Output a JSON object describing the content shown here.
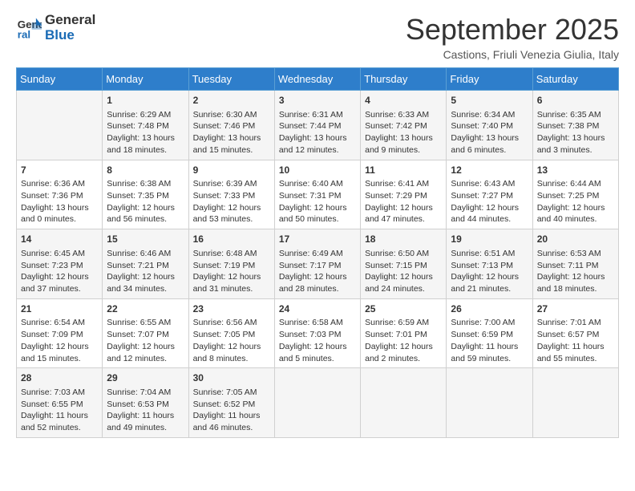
{
  "logo": {
    "line1": "General",
    "line2": "Blue"
  },
  "title": "September 2025",
  "location": "Castions, Friuli Venezia Giulia, Italy",
  "days_of_week": [
    "Sunday",
    "Monday",
    "Tuesday",
    "Wednesday",
    "Thursday",
    "Friday",
    "Saturday"
  ],
  "weeks": [
    [
      {
        "day": "",
        "info": ""
      },
      {
        "day": "1",
        "info": "Sunrise: 6:29 AM\nSunset: 7:48 PM\nDaylight: 13 hours\nand 18 minutes."
      },
      {
        "day": "2",
        "info": "Sunrise: 6:30 AM\nSunset: 7:46 PM\nDaylight: 13 hours\nand 15 minutes."
      },
      {
        "day": "3",
        "info": "Sunrise: 6:31 AM\nSunset: 7:44 PM\nDaylight: 13 hours\nand 12 minutes."
      },
      {
        "day": "4",
        "info": "Sunrise: 6:33 AM\nSunset: 7:42 PM\nDaylight: 13 hours\nand 9 minutes."
      },
      {
        "day": "5",
        "info": "Sunrise: 6:34 AM\nSunset: 7:40 PM\nDaylight: 13 hours\nand 6 minutes."
      },
      {
        "day": "6",
        "info": "Sunrise: 6:35 AM\nSunset: 7:38 PM\nDaylight: 13 hours\nand 3 minutes."
      }
    ],
    [
      {
        "day": "7",
        "info": "Sunrise: 6:36 AM\nSunset: 7:36 PM\nDaylight: 13 hours\nand 0 minutes."
      },
      {
        "day": "8",
        "info": "Sunrise: 6:38 AM\nSunset: 7:35 PM\nDaylight: 12 hours\nand 56 minutes."
      },
      {
        "day": "9",
        "info": "Sunrise: 6:39 AM\nSunset: 7:33 PM\nDaylight: 12 hours\nand 53 minutes."
      },
      {
        "day": "10",
        "info": "Sunrise: 6:40 AM\nSunset: 7:31 PM\nDaylight: 12 hours\nand 50 minutes."
      },
      {
        "day": "11",
        "info": "Sunrise: 6:41 AM\nSunset: 7:29 PM\nDaylight: 12 hours\nand 47 minutes."
      },
      {
        "day": "12",
        "info": "Sunrise: 6:43 AM\nSunset: 7:27 PM\nDaylight: 12 hours\nand 44 minutes."
      },
      {
        "day": "13",
        "info": "Sunrise: 6:44 AM\nSunset: 7:25 PM\nDaylight: 12 hours\nand 40 minutes."
      }
    ],
    [
      {
        "day": "14",
        "info": "Sunrise: 6:45 AM\nSunset: 7:23 PM\nDaylight: 12 hours\nand 37 minutes."
      },
      {
        "day": "15",
        "info": "Sunrise: 6:46 AM\nSunset: 7:21 PM\nDaylight: 12 hours\nand 34 minutes."
      },
      {
        "day": "16",
        "info": "Sunrise: 6:48 AM\nSunset: 7:19 PM\nDaylight: 12 hours\nand 31 minutes."
      },
      {
        "day": "17",
        "info": "Sunrise: 6:49 AM\nSunset: 7:17 PM\nDaylight: 12 hours\nand 28 minutes."
      },
      {
        "day": "18",
        "info": "Sunrise: 6:50 AM\nSunset: 7:15 PM\nDaylight: 12 hours\nand 24 minutes."
      },
      {
        "day": "19",
        "info": "Sunrise: 6:51 AM\nSunset: 7:13 PM\nDaylight: 12 hours\nand 21 minutes."
      },
      {
        "day": "20",
        "info": "Sunrise: 6:53 AM\nSunset: 7:11 PM\nDaylight: 12 hours\nand 18 minutes."
      }
    ],
    [
      {
        "day": "21",
        "info": "Sunrise: 6:54 AM\nSunset: 7:09 PM\nDaylight: 12 hours\nand 15 minutes."
      },
      {
        "day": "22",
        "info": "Sunrise: 6:55 AM\nSunset: 7:07 PM\nDaylight: 12 hours\nand 12 minutes."
      },
      {
        "day": "23",
        "info": "Sunrise: 6:56 AM\nSunset: 7:05 PM\nDaylight: 12 hours\nand 8 minutes."
      },
      {
        "day": "24",
        "info": "Sunrise: 6:58 AM\nSunset: 7:03 PM\nDaylight: 12 hours\nand 5 minutes."
      },
      {
        "day": "25",
        "info": "Sunrise: 6:59 AM\nSunset: 7:01 PM\nDaylight: 12 hours\nand 2 minutes."
      },
      {
        "day": "26",
        "info": "Sunrise: 7:00 AM\nSunset: 6:59 PM\nDaylight: 11 hours\nand 59 minutes."
      },
      {
        "day": "27",
        "info": "Sunrise: 7:01 AM\nSunset: 6:57 PM\nDaylight: 11 hours\nand 55 minutes."
      }
    ],
    [
      {
        "day": "28",
        "info": "Sunrise: 7:03 AM\nSunset: 6:55 PM\nDaylight: 11 hours\nand 52 minutes."
      },
      {
        "day": "29",
        "info": "Sunrise: 7:04 AM\nSunset: 6:53 PM\nDaylight: 11 hours\nand 49 minutes."
      },
      {
        "day": "30",
        "info": "Sunrise: 7:05 AM\nSunset: 6:52 PM\nDaylight: 11 hours\nand 46 minutes."
      },
      {
        "day": "",
        "info": ""
      },
      {
        "day": "",
        "info": ""
      },
      {
        "day": "",
        "info": ""
      },
      {
        "day": "",
        "info": ""
      }
    ]
  ]
}
